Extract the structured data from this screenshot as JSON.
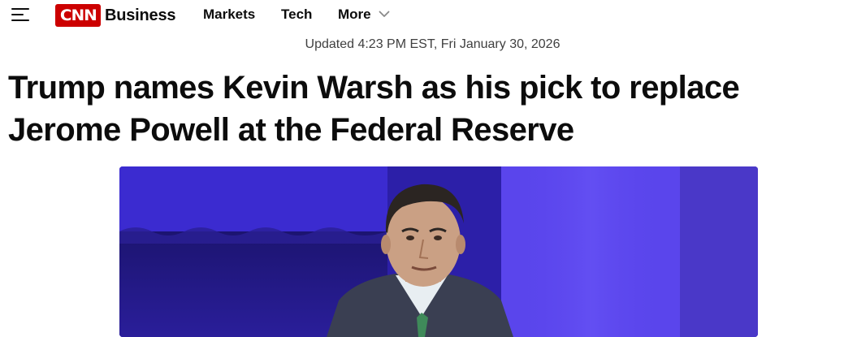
{
  "nav": {
    "logo_text": "CNN",
    "section": "Business",
    "links": [
      "Markets",
      "Tech",
      "More"
    ],
    "brand_color": "#cc0000"
  },
  "article": {
    "updated": "Updated 4:23 PM EST, Fri January 30, 2026",
    "headline": "Trump names Kevin Warsh as his pick to replace Jerome Powell at the Federal Reserve"
  },
  "photo": {
    "subject": "man in a suit speaking in front of a purple backdrop"
  }
}
